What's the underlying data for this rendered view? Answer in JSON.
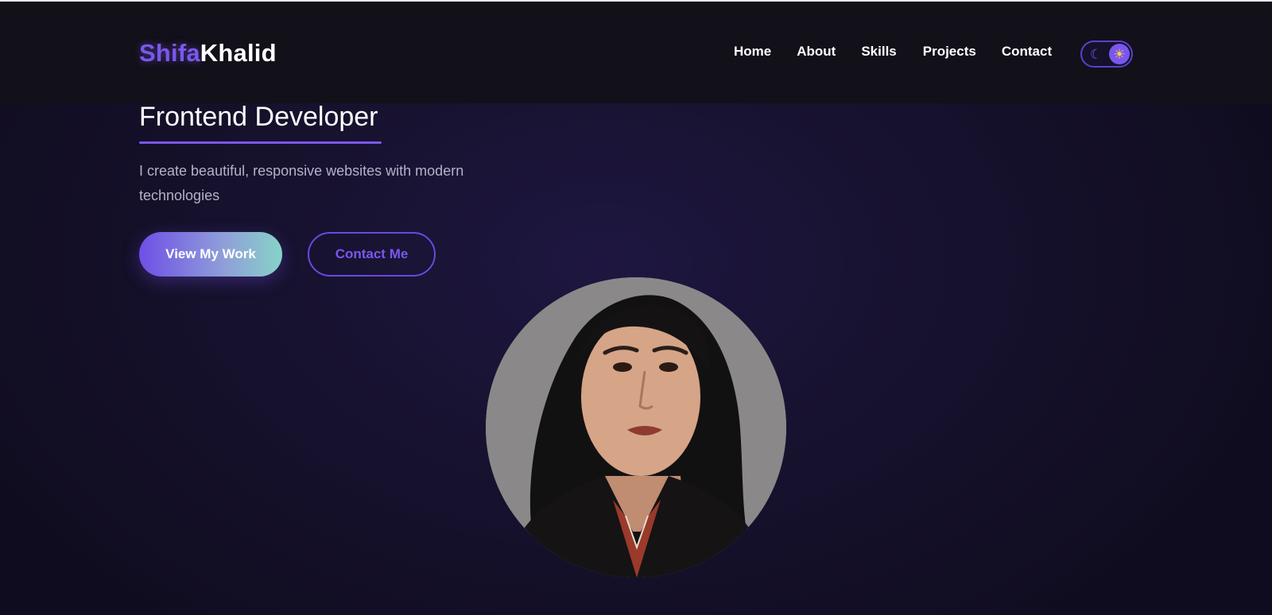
{
  "header": {
    "logo_first": "Shifa",
    "logo_last": "Khalid",
    "nav": [
      {
        "label": "Home"
      },
      {
        "label": "About"
      },
      {
        "label": "Skills"
      },
      {
        "label": "Projects"
      },
      {
        "label": "Contact"
      }
    ],
    "theme_toggle": {
      "left_icon": "moon-icon",
      "right_icon": "sun-icon",
      "active": "dark"
    }
  },
  "hero": {
    "title": "Frontend Developer",
    "subtitle": "I create beautiful, responsive websites with modern technologies",
    "primary_button": "View My Work",
    "secondary_button": "Contact Me"
  },
  "avatar": {
    "icon": "profile-photo"
  },
  "colors": {
    "accent": "#7a57ec",
    "background": "#100c1f",
    "nav_background": "#121019",
    "button_gradient_start": "#6f4fe6",
    "button_gradient_end": "#86d3c8"
  }
}
